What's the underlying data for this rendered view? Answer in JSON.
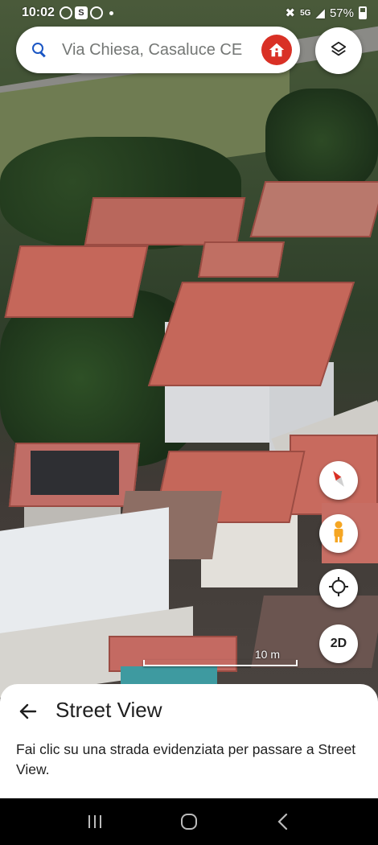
{
  "status_bar": {
    "time": "10:02",
    "notification_icons": [
      "whatsapp-icon",
      "s-app-icon",
      "whatsapp-icon"
    ],
    "network": "5G",
    "battery": "57%"
  },
  "search": {
    "placeholder": "Via Chiesa, Casaluce CE"
  },
  "map": {
    "scale_label": "10 m",
    "view_toggle_label": "2D"
  },
  "sheet": {
    "title": "Street View",
    "description": "Fai clic su una strada evidenziata per passare a Street View."
  },
  "colors": {
    "accent_blue": "#1a56c4",
    "home_red": "#d93025",
    "pegman_orange": "#f5a623"
  }
}
